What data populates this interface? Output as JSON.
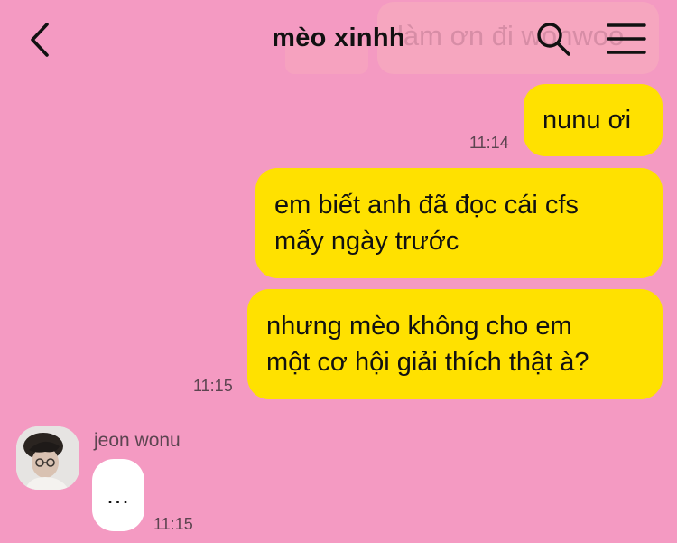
{
  "header": {
    "title": "mèo xinhh",
    "ghost_search_text": "làm ơn đi wonwoo"
  },
  "messages": [
    {
      "text": "nunu ơi",
      "time": "11:14"
    },
    {
      "text": "em biết anh đã đọc cái cfs mấy ngày trước",
      "line1": "em biết anh đã đọc cái cfs",
      "line2": "mấy ngày trước"
    },
    {
      "text": "nhưng mèo không cho em một cơ hội giải thích thật à?",
      "line1": "nhưng mèo không cho em",
      "line2": "một cơ hội giải thích thật à?",
      "time": "11:15"
    }
  ],
  "incoming": {
    "sender": "jeon wonu",
    "text": "...",
    "time": "11:15"
  },
  "colors": {
    "background": "#f49ac2",
    "outgoing_bubble": "#ffe100",
    "incoming_bubble": "#ffffff"
  },
  "icons": {
    "back": "chevron-left-icon",
    "search": "search-icon",
    "menu": "hamburger-menu-icon",
    "avatar": "profile-photo"
  }
}
